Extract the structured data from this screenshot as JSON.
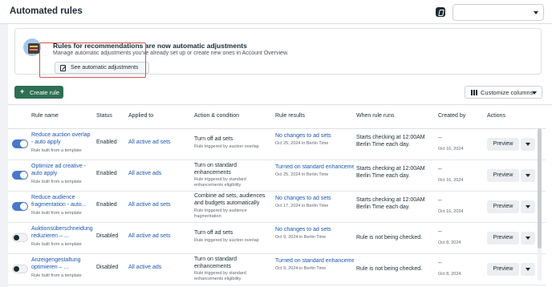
{
  "page": {
    "title": "Automated rules"
  },
  "header": {
    "account_select_value": ""
  },
  "banner": {
    "title": "Rules for recommendations are now automatic adjustments",
    "subtitle": "Manage automatic adjustments you've already set up or create new ones in Account Overview.",
    "button_label": "See automatic adjustments"
  },
  "toolbar": {
    "create_label": "Create rule",
    "create_icon": "plus-icon",
    "customize_label": "Customize columns"
  },
  "table": {
    "columns": [
      "Rule name",
      "Status",
      "Applied to",
      "Action & condition",
      "Rule results",
      "When rule runs",
      "Created by",
      "Actions"
    ],
    "rows": [
      {
        "enabled": true,
        "name": "Reduce auction overlap - auto apply",
        "sub": "Rule built from a template",
        "status": "Enabled",
        "applied": "All active ad sets",
        "action": "Turn off ad sets",
        "condition": "Rule triggered by auction overlap",
        "result": "No changes to ad sets",
        "result_date": "Oct 25, 2024 in Berlin Time",
        "runs": "Starts checking at 12:00AM Berlin Time each day.",
        "created_by": "--",
        "created_date": "Oct 16, 2024",
        "preview": "Preview"
      },
      {
        "enabled": true,
        "name": "Optimize ad creative - auto apply",
        "sub": "Rule built from a template",
        "status": "Enabled",
        "applied": "All active ads",
        "action": "Turn on standard enhancements",
        "condition": "Rule triggered by standard enhancements eligibility",
        "result": "Turned on standard enhanceme",
        "result_date": "Oct 25, 2024 in Berlin Time",
        "runs": "Starts checking at 12:00AM Berlin Time each day.",
        "created_by": "--",
        "created_date": "Oct 16, 2024",
        "preview": "Preview"
      },
      {
        "enabled": true,
        "name": "Reduce audience fragmentation - auto...",
        "sub": "Rule built from a template",
        "status": "Enabled",
        "applied": "All active ad sets",
        "action": "Combine ad sets, audiences and budgets automatically",
        "condition": "Rule triggered by audience fragmentation",
        "result": "No changes to ad sets",
        "result_date": "Oct 17, 2024 in Berlin Time",
        "runs": "Starts checking at 12:00AM Berlin Time each day.",
        "created_by": "--",
        "created_date": "Oct 16, 2024",
        "preview": "Preview"
      },
      {
        "enabled": false,
        "name": "Auktionsüberschneidung reduzieren – ...",
        "sub": "Rule built from a template",
        "status": "Disabled",
        "applied": "All active ad sets",
        "action": "Turn off ad sets",
        "condition": "Rule triggered by auction overlap",
        "result": "No changes to ad sets",
        "result_date": "Oct 9, 2024 in Berlin Time",
        "runs": "Rule is not being checked.",
        "created_by": "--",
        "created_date": "Oct 8, 2024",
        "preview": "Preview"
      },
      {
        "enabled": false,
        "name": "Anzeigengestaltung optimieren – ...",
        "sub": "Rule built from a template",
        "status": "Disabled",
        "applied": "All active ads",
        "action": "Turn on standard enhancements",
        "condition": "Rule triggered by standard enhancements eligibility",
        "result": "Turned on standard enhanceme",
        "result_date": "Oct 9, 2024 in Berlin Time",
        "runs": "Rule is not being checked.",
        "created_by": "--",
        "created_date": "Oct 8, 2024",
        "preview": "Preview"
      }
    ]
  },
  "colors": {
    "accent_green": "#2e6f52",
    "link_blue": "#1a56b0",
    "toggle_on": "#4a78c9",
    "highlight_red": "#d9534f"
  }
}
